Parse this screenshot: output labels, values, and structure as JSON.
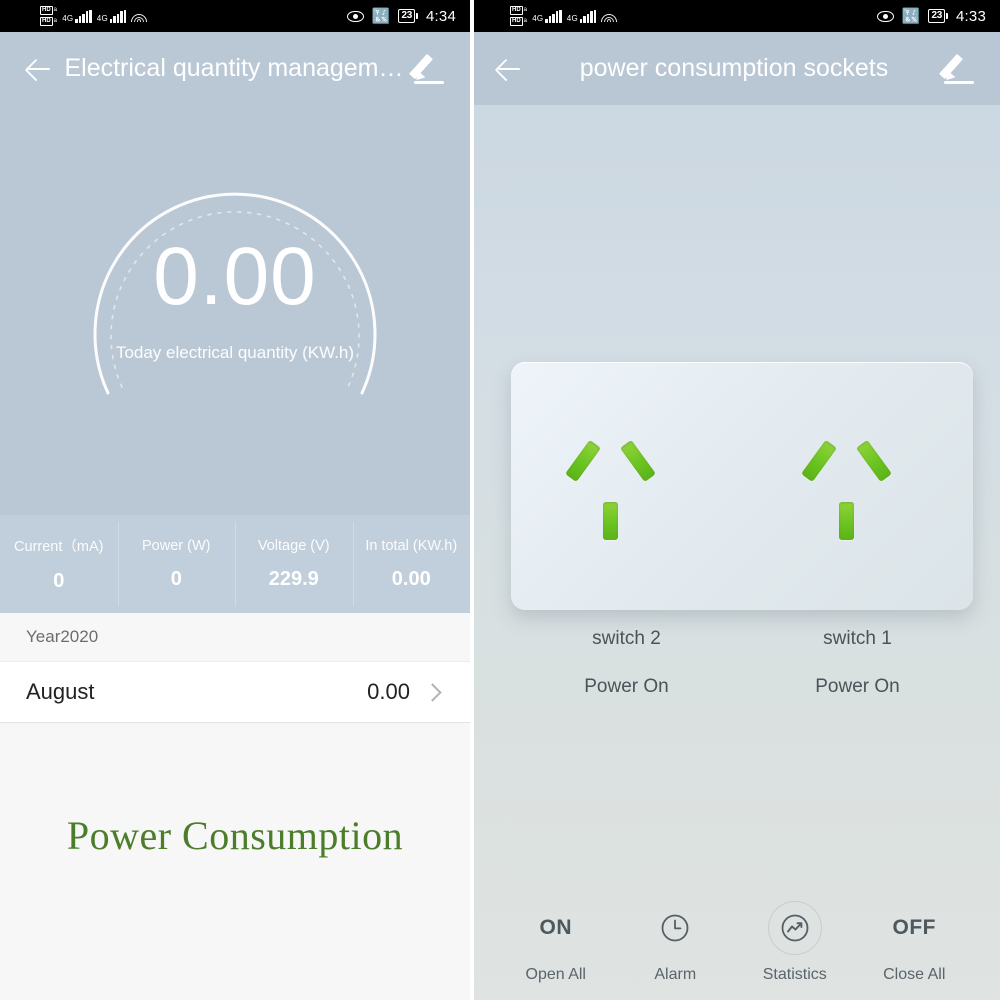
{
  "left": {
    "statusbar": {
      "hd_badge": "HD",
      "hd_sub": "a",
      "network_label": "4G",
      "icons": [
        "hd-voice-icon",
        "signal-bars-icon",
        "signal-bars-icon",
        "wifi-icon",
        "eye-icon",
        "bluetooth-icon",
        "battery-icon"
      ],
      "battery_level": "23",
      "time": "4:34"
    },
    "header": {
      "title": "Electrical quantity managem…",
      "back_icon": "back-arrow-icon",
      "edit_icon": "pencil-icon"
    },
    "gauge": {
      "value": "0.00",
      "label": "Today electrical quantity (KW.h)"
    },
    "stats": [
      {
        "label": "Current（mA)",
        "value": "0"
      },
      {
        "label": "Power (W)",
        "value": "0"
      },
      {
        "label": "Voltage (V)",
        "value": "229.9"
      },
      {
        "label": "In total (KW.h)",
        "value": "0.00"
      }
    ],
    "list": {
      "section_title": "Year2020",
      "rows": [
        {
          "name": "August",
          "value": "0.00",
          "chevron": "chevron-right-icon"
        }
      ]
    },
    "caption": "Power Consumption"
  },
  "right": {
    "statusbar": {
      "hd_badge": "HD",
      "hd_sub": "a",
      "network_label": "4G",
      "battery_level": "23",
      "time": "4:33"
    },
    "header": {
      "title": "power consumption sockets",
      "back_icon": "back-arrow-icon",
      "edit_icon": "pencil-icon"
    },
    "socket": {
      "card_name": "socket-panel-card",
      "outlets": [
        {
          "name": "outlet-left",
          "pin_color": "#6cc421"
        },
        {
          "name": "outlet-right",
          "pin_color": "#6cc421"
        }
      ]
    },
    "switches": [
      {
        "name": "switch 2",
        "state": "Power On"
      },
      {
        "name": "switch 1",
        "state": "Power On"
      }
    ],
    "bottombar": [
      {
        "icon": "on-text-icon",
        "text": "ON",
        "label": "Open All"
      },
      {
        "icon": "clock-icon",
        "text": "",
        "label": "Alarm"
      },
      {
        "icon": "trend-chart-icon",
        "text": "",
        "label": "Statistics"
      },
      {
        "icon": "off-text-icon",
        "text": "OFF",
        "label": "Close All"
      }
    ]
  },
  "colors": {
    "header_blue": "#bac8d6",
    "stats_blue": "#c1cedb",
    "caption_green": "#4b7d2a",
    "pin_green": "#6cc421",
    "panel_right_bg": "#d6dfe1"
  }
}
